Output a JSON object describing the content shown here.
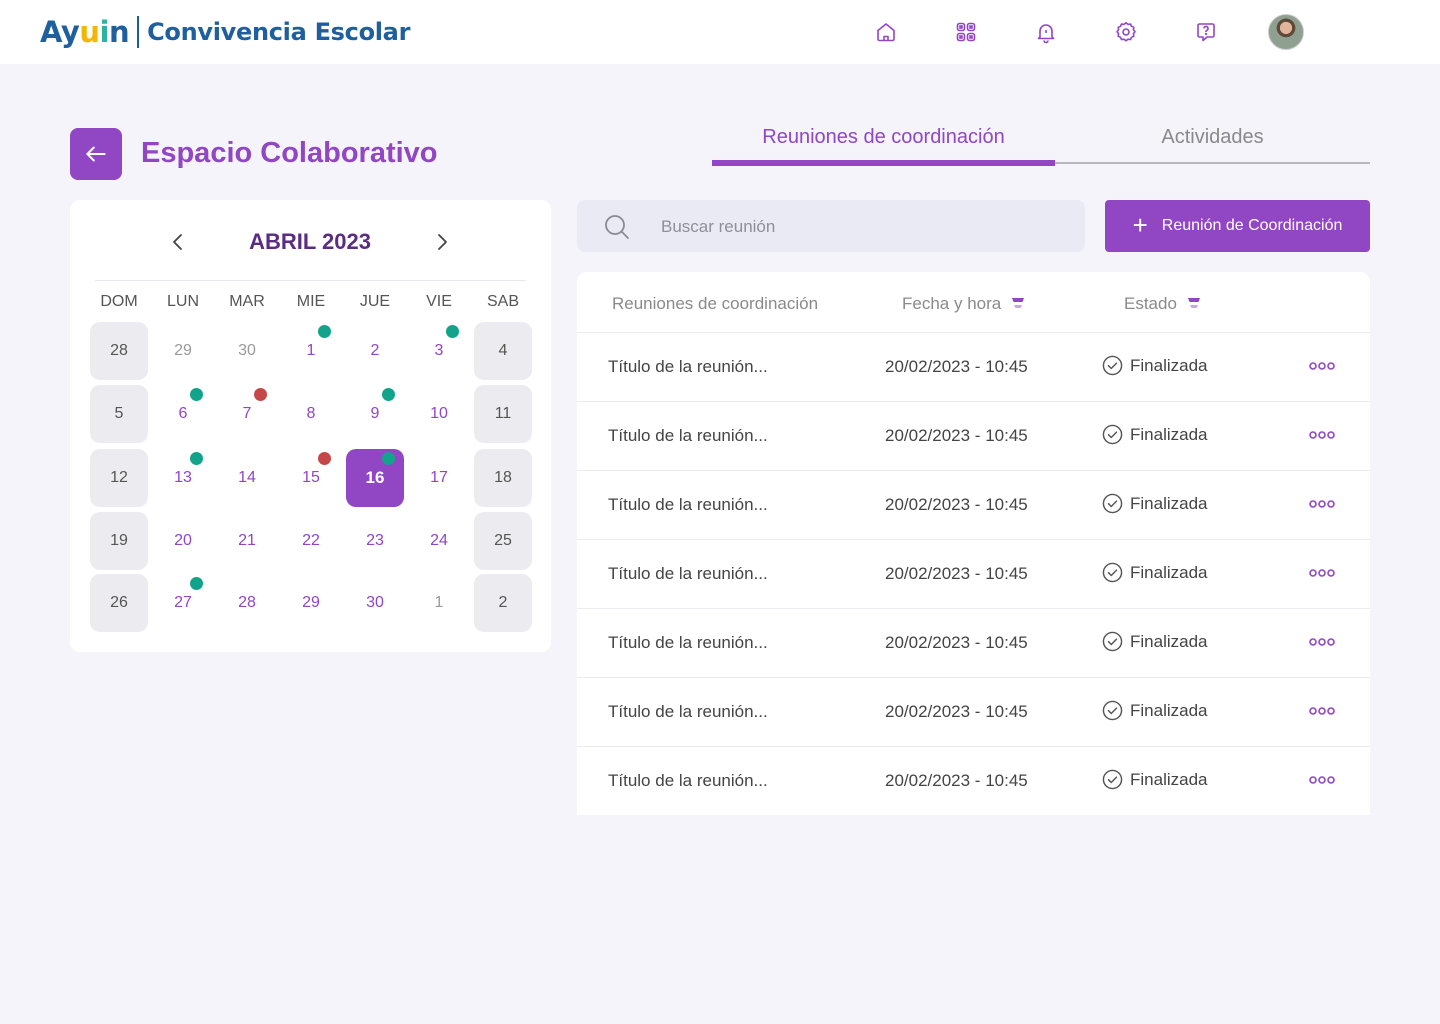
{
  "header": {
    "logo_part_1": "Ay",
    "logo_part_u": "u",
    "logo_part_i": "i",
    "logo_part_2": "n",
    "app_name": "Convivencia Escolar",
    "icons": [
      "home-icon",
      "qr-code-icon",
      "bell-icon",
      "gear-icon",
      "help-icon"
    ]
  },
  "page": {
    "title": "Espacio Colaborativo"
  },
  "tabs": [
    {
      "label": "Reuniones de coordinación",
      "active": true
    },
    {
      "label": "Actividades",
      "active": false
    }
  ],
  "calendar": {
    "month_label": "ABRIL 2023",
    "weekdays": [
      "DOM",
      "LUN",
      "MAR",
      "MIE",
      "JUE",
      "VIE",
      "SAB"
    ],
    "weeks": [
      [
        {
          "d": "28",
          "t": "weekend"
        },
        {
          "d": "29",
          "t": "other"
        },
        {
          "d": "30",
          "t": "other"
        },
        {
          "d": "1",
          "t": "cur",
          "dot": "green"
        },
        {
          "d": "2",
          "t": "cur"
        },
        {
          "d": "3",
          "t": "cur",
          "dot": "green"
        },
        {
          "d": "4",
          "t": "weekend"
        }
      ],
      [
        {
          "d": "5",
          "t": "weekend"
        },
        {
          "d": "6",
          "t": "cur",
          "dot": "green"
        },
        {
          "d": "7",
          "t": "cur",
          "dot": "red"
        },
        {
          "d": "8",
          "t": "cur"
        },
        {
          "d": "9",
          "t": "cur",
          "dot": "green"
        },
        {
          "d": "10",
          "t": "cur"
        },
        {
          "d": "11",
          "t": "weekend"
        }
      ],
      [
        {
          "d": "12",
          "t": "weekend"
        },
        {
          "d": "13",
          "t": "cur",
          "dot": "green"
        },
        {
          "d": "14",
          "t": "cur"
        },
        {
          "d": "15",
          "t": "cur",
          "dot": "red"
        },
        {
          "d": "16",
          "t": "selected",
          "dot": "green"
        },
        {
          "d": "17",
          "t": "cur"
        },
        {
          "d": "18",
          "t": "weekend"
        }
      ],
      [
        {
          "d": "19",
          "t": "weekend"
        },
        {
          "d": "20",
          "t": "cur"
        },
        {
          "d": "21",
          "t": "cur"
        },
        {
          "d": "22",
          "t": "cur"
        },
        {
          "d": "23",
          "t": "cur"
        },
        {
          "d": "24",
          "t": "cur"
        },
        {
          "d": "25",
          "t": "weekend"
        }
      ],
      [
        {
          "d": "26",
          "t": "weekend"
        },
        {
          "d": "27",
          "t": "cur",
          "dot": "green"
        },
        {
          "d": "28",
          "t": "cur"
        },
        {
          "d": "29",
          "t": "cur"
        },
        {
          "d": "30",
          "t": "cur"
        },
        {
          "d": "1",
          "t": "other"
        },
        {
          "d": "2",
          "t": "weekend"
        }
      ]
    ]
  },
  "search": {
    "placeholder": "Buscar reunión"
  },
  "add_button": {
    "plus": "+",
    "label": "Reunión de Coordinación"
  },
  "table": {
    "headers": {
      "title": "Reuniones de coordinación",
      "date": "Fecha y hora",
      "status": "Estado"
    },
    "rows": [
      {
        "title": "Título de la reunión...",
        "date": "20/02/2023 - 10:45",
        "status": "Finalizada"
      },
      {
        "title": "Título de la reunión...",
        "date": "20/02/2023 - 10:45",
        "status": "Finalizada"
      },
      {
        "title": "Título de la reunión...",
        "date": "20/02/2023 - 10:45",
        "status": "Finalizada"
      },
      {
        "title": "Título de la reunión...",
        "date": "20/02/2023 - 10:45",
        "status": "Finalizada"
      },
      {
        "title": "Título de la reunión...",
        "date": "20/02/2023 - 10:45",
        "status": "Finalizada"
      },
      {
        "title": "Título de la reunión...",
        "date": "20/02/2023 - 10:45",
        "status": "Finalizada"
      },
      {
        "title": "Título de la reunión...",
        "date": "20/02/2023 - 10:45",
        "status": "Finalizada"
      }
    ]
  },
  "colors": {
    "primary": "#9146c4",
    "brand_blue": "#1f5f9e",
    "dot_green": "#12a38a",
    "dot_red": "#c44848",
    "page_bg": "#f4f4fa"
  }
}
